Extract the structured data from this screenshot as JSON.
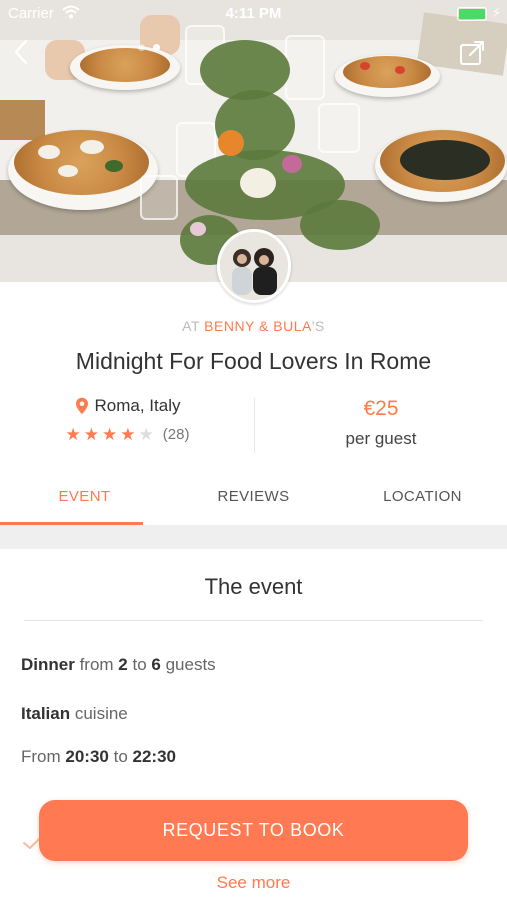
{
  "status_bar": {
    "carrier": "Carrier",
    "time": "4:11 PM"
  },
  "hero": {
    "photo_description_icon": "dinner-table-photo",
    "page_count": 2,
    "active_page": 2
  },
  "host": {
    "prefix": "AT ",
    "name": "BENNY & BULA",
    "suffix": "'S"
  },
  "event": {
    "title": "Midnight For Food Lovers In Rome",
    "location": "Roma, Italy",
    "rating_stars": 4,
    "rating_max": 5,
    "rating_count": "(28)",
    "price": "€25",
    "price_unit": "per guest"
  },
  "tabs": [
    {
      "label": "EVENT",
      "active": true
    },
    {
      "label": "REVIEWS",
      "active": false
    },
    {
      "label": "LOCATION",
      "active": false
    }
  ],
  "section": {
    "title": "The event",
    "details": {
      "meal_type": "Dinner",
      "guests_from_word": " from ",
      "guests_min": "2",
      "guests_to_word": " to ",
      "guests_max": "6",
      "guests_suffix": " guests",
      "cuisine": "Italian",
      "cuisine_suffix": " cuisine",
      "time_prefix": "From ",
      "time_start": "20:30",
      "time_to_word": " to ",
      "time_end": "22:30"
    }
  },
  "actions": {
    "book_label": "REQUEST TO BOOK",
    "see_more_label": "See more"
  },
  "colors": {
    "accent": "#ff7a4d",
    "button": "#ff7a52",
    "star_off": "#dddddd"
  }
}
